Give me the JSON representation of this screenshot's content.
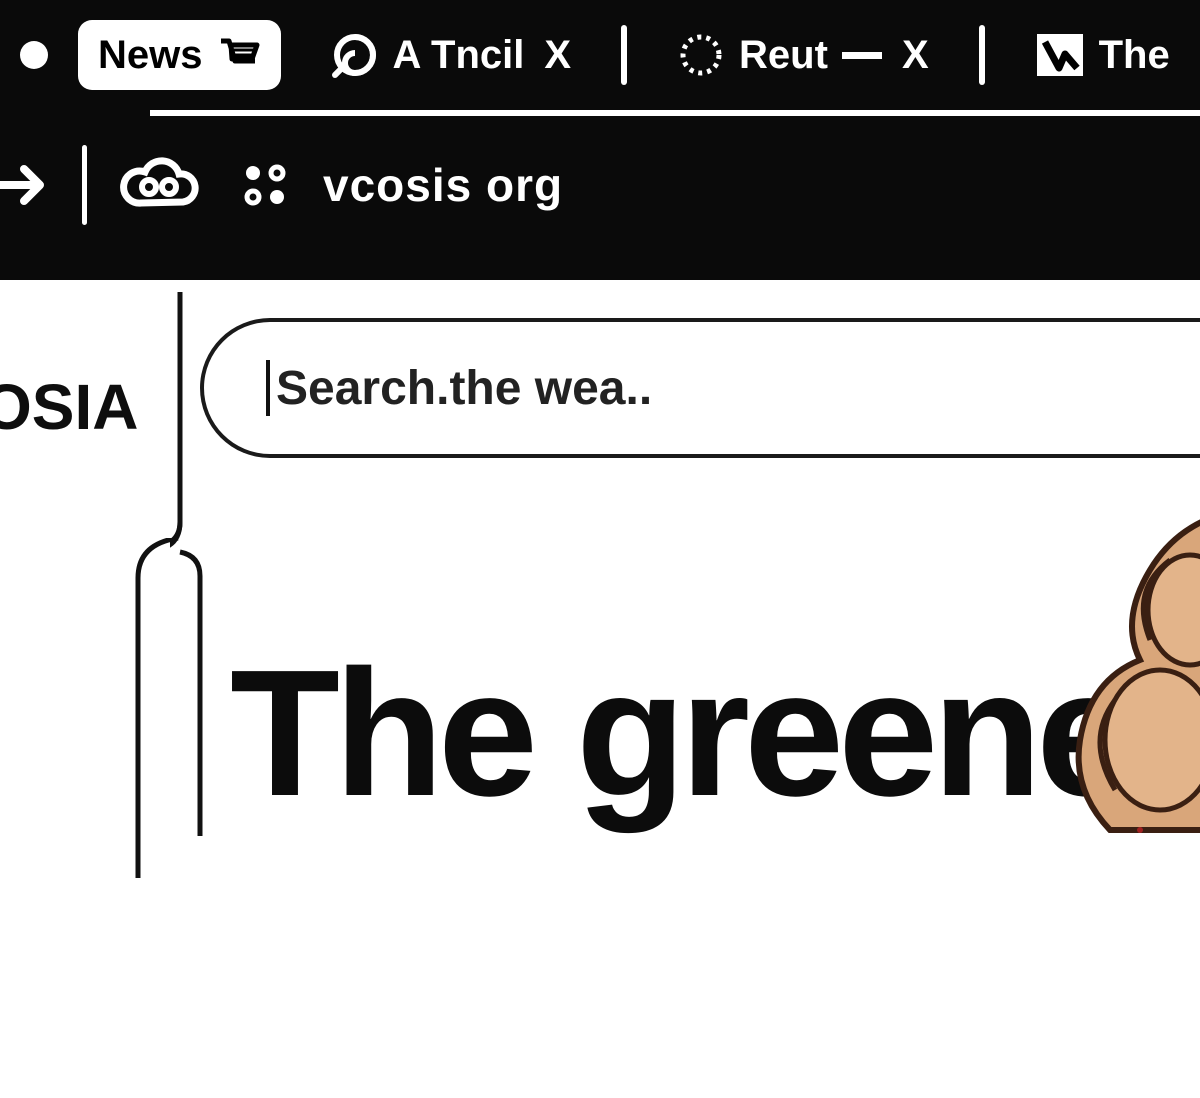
{
  "chrome": {
    "tabs": [
      {
        "label": "News"
      },
      {
        "label": "A Tncil"
      },
      {
        "label": "Reut"
      },
      {
        "label": "The"
      }
    ],
    "address": "vcosis org"
  },
  "page": {
    "logo": "OSIA",
    "search_placeholder": "Search.the wea..",
    "headline": "The greene"
  }
}
